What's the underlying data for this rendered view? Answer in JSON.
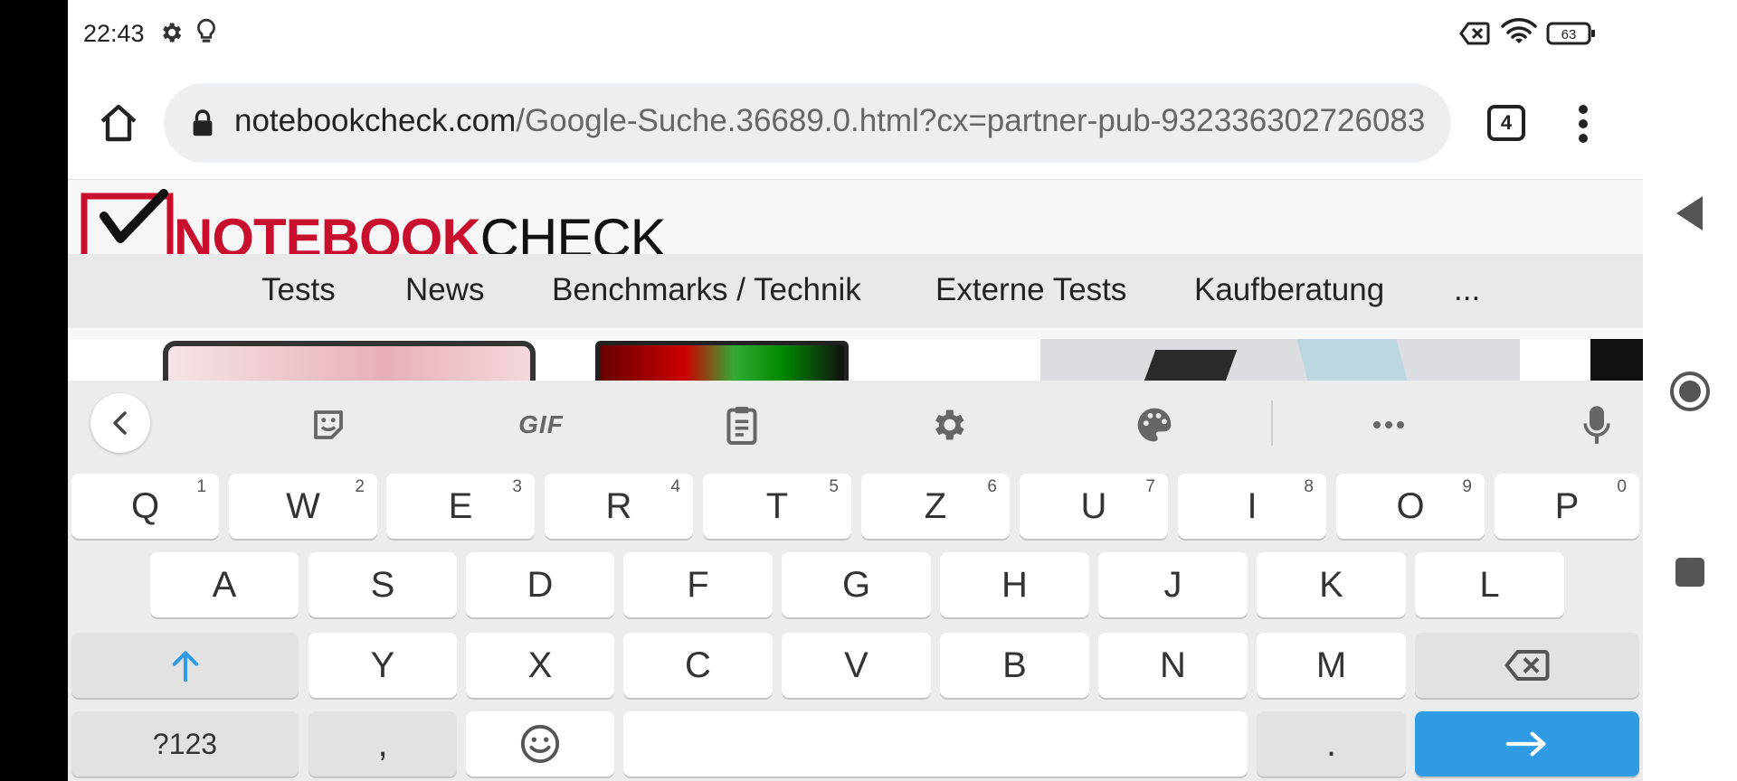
{
  "status_bar": {
    "time": "22:43",
    "battery": "63",
    "icons": [
      "settings-icon",
      "lightbulb-icon",
      "no-sim-icon",
      "wifi-icon",
      "battery-icon"
    ]
  },
  "browser": {
    "url_domain": "notebookcheck.com",
    "url_path": "/Google-Suche.36689.0.html?cx=partner-pub-932336302726083",
    "tab_count": "4"
  },
  "site": {
    "logo_red": "NOTEBOOK",
    "logo_black": "CHECK",
    "menu": [
      "Tests",
      "News",
      "Benchmarks / Technik",
      "Externe Tests",
      "Kaufberatung",
      "..."
    ]
  },
  "keyboard": {
    "toolbar": {
      "gif_label": "GIF"
    },
    "row1": [
      {
        "key": "Q",
        "hint": "1"
      },
      {
        "key": "W",
        "hint": "2"
      },
      {
        "key": "E",
        "hint": "3"
      },
      {
        "key": "R",
        "hint": "4"
      },
      {
        "key": "T",
        "hint": "5"
      },
      {
        "key": "Z",
        "hint": "6"
      },
      {
        "key": "U",
        "hint": "7"
      },
      {
        "key": "I",
        "hint": "8"
      },
      {
        "key": "O",
        "hint": "9"
      },
      {
        "key": "P",
        "hint": "0"
      }
    ],
    "row2": [
      "A",
      "S",
      "D",
      "F",
      "G",
      "H",
      "J",
      "K",
      "L"
    ],
    "row3": [
      "Y",
      "X",
      "C",
      "V",
      "B",
      "N",
      "M"
    ],
    "symbols_label": "?123",
    "comma_label": ",",
    "period_label": "."
  },
  "colors": {
    "accent": "#2f9be4",
    "brand_red": "#c8102e"
  }
}
